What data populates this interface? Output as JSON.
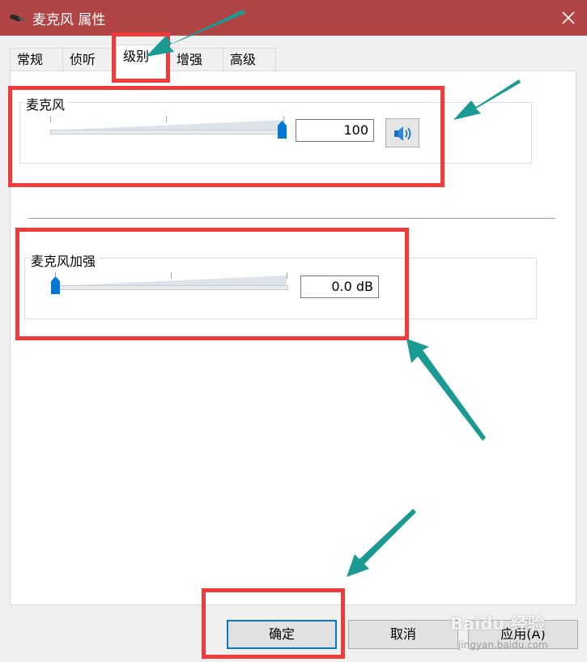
{
  "window": {
    "title": "麦克风 属性"
  },
  "tabs": [
    {
      "label": "常规",
      "active": false
    },
    {
      "label": "侦听",
      "active": false
    },
    {
      "label": "级别",
      "active": true
    },
    {
      "label": "增强",
      "active": false
    },
    {
      "label": "高级",
      "active": false
    }
  ],
  "microphone": {
    "label": "麦克风",
    "value_text": "100",
    "level": 1.0
  },
  "boost": {
    "label": "麦克风加强",
    "value_text": "0.0 dB",
    "level": 0.0
  },
  "buttons": {
    "ok": "确定",
    "cancel": "取消",
    "apply": "应用(A)"
  },
  "watermark": {
    "brand": "Baidu 经验",
    "url": "jingyan.baidu.com"
  },
  "colors": {
    "titlebar": "#b14445",
    "annotation_box": "#f13a3a",
    "annotation_arrow": "#1b9a94",
    "slider_thumb": "#0078d7"
  }
}
